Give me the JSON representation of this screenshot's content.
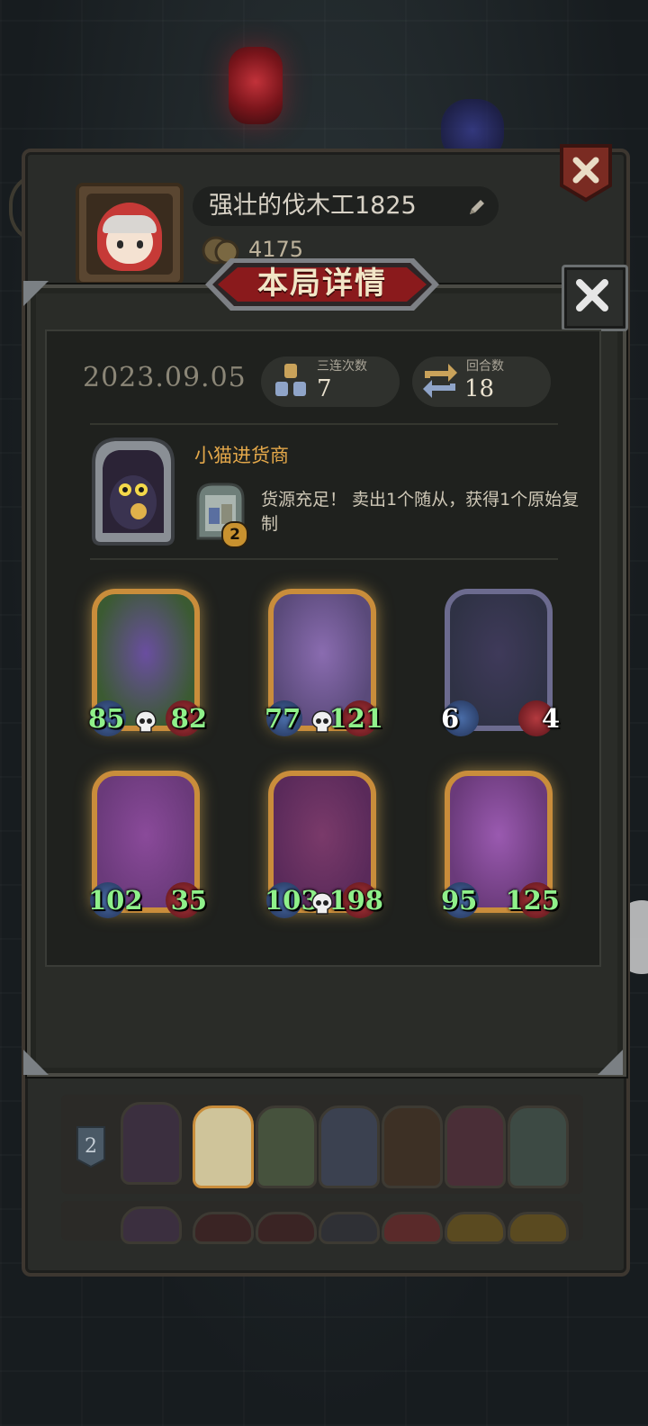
{
  "profile": {
    "username": "强壮的伐木工1825",
    "coins": "4175"
  },
  "modal": {
    "title": "本局详情",
    "date": "2023.09.05",
    "triples": {
      "label": "三连次数",
      "value": "7"
    },
    "rounds": {
      "label": "回合数",
      "value": "18"
    },
    "hero": {
      "name": "小猫进货商",
      "power_level": "2",
      "description": "货源充足！ 卖出1个随从，获得1个原始复制"
    },
    "cards": [
      {
        "name": "vine-guardian",
        "attack": "85",
        "health": "82",
        "frame": "gold",
        "skull": true,
        "attack_color": "#8ff08a",
        "health_color": "#8ff08a"
      },
      {
        "name": "stone-golem",
        "attack": "77",
        "health": "121",
        "frame": "gold",
        "skull": true,
        "attack_color": "#8ff08a",
        "health_color": "#8ff08a"
      },
      {
        "name": "mushroom-spider",
        "attack": "6",
        "health": "4",
        "frame": "silver",
        "skull": false,
        "attack_color": "#ffffff",
        "health_color": "#ffffff"
      },
      {
        "name": "swamp-witch",
        "attack": "102",
        "health": "35",
        "frame": "gold",
        "skull": false,
        "attack_color": "#8ff08a",
        "health_color": "#8ff08a"
      },
      {
        "name": "rose-dryad",
        "attack": "103",
        "health": "198",
        "frame": "gold",
        "skull": true,
        "attack_color": "#8ff08a",
        "health_color": "#8ff08a"
      },
      {
        "name": "mushroom-spider-golden",
        "attack": "95",
        "health": "125",
        "frame": "gold",
        "skull": false,
        "attack_color": "#8ff08a",
        "health_color": "#8ff08a"
      }
    ]
  },
  "history": {
    "row1_rank": "2"
  }
}
